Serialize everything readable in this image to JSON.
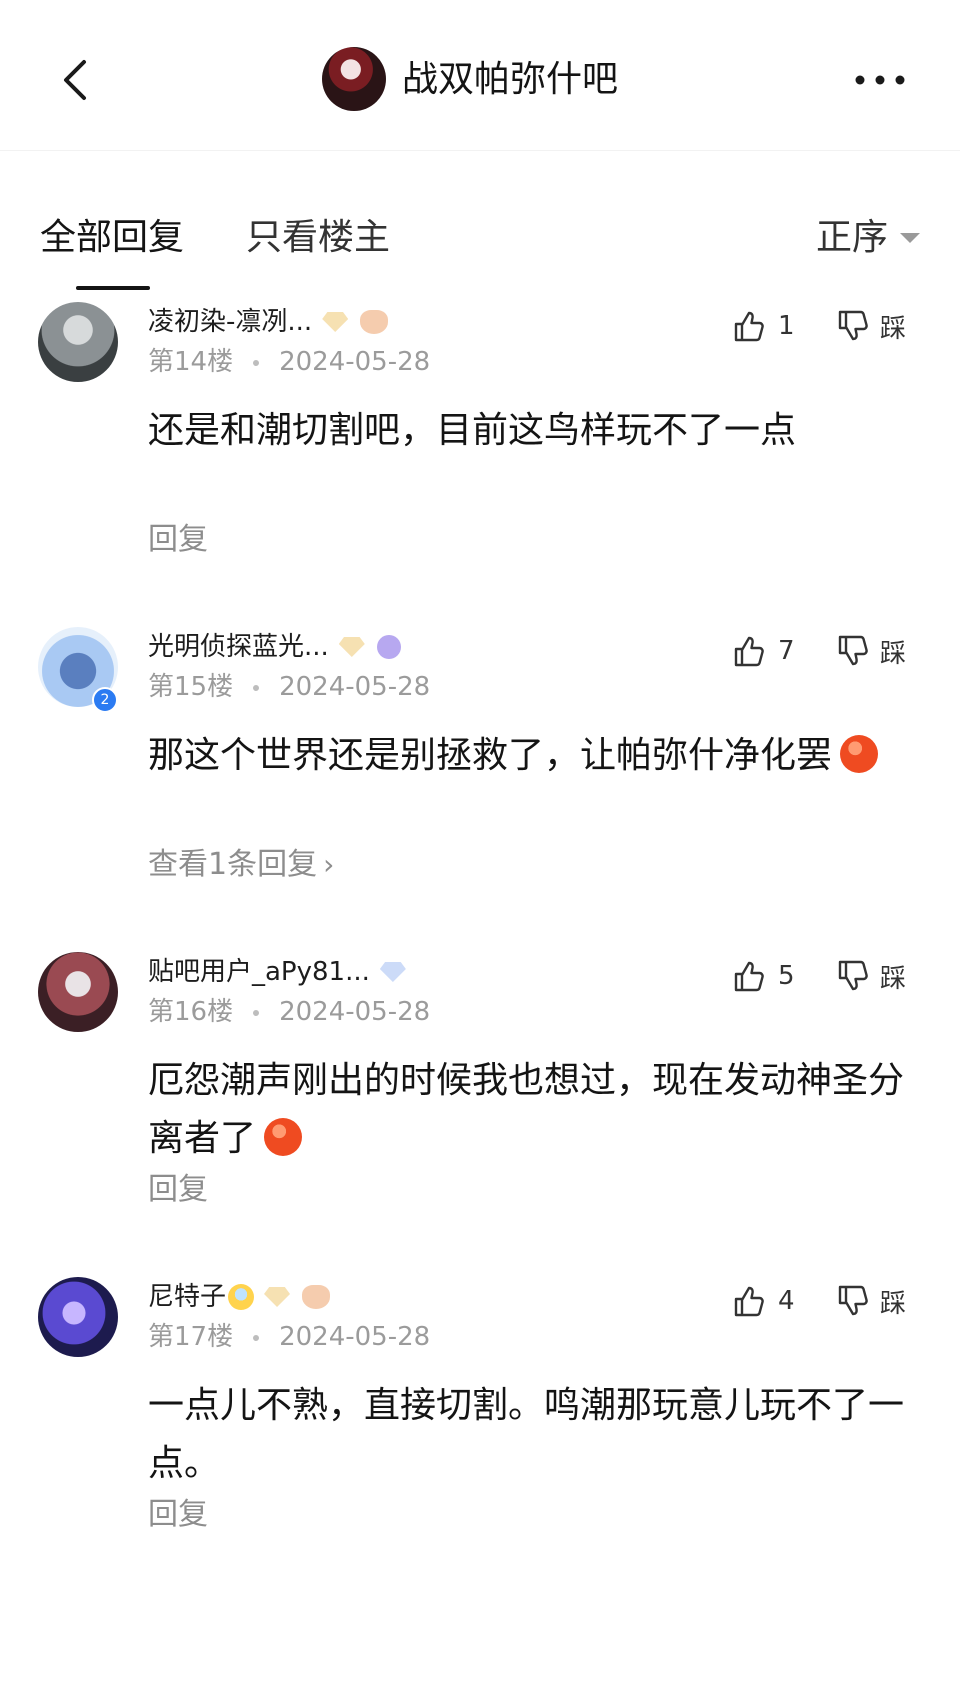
{
  "header": {
    "back_icon": "chevron-left-icon",
    "forum_title": "战双帕弥什吧",
    "more_icon": "more-dots-icon"
  },
  "tabs": {
    "all": "全部回复",
    "op_only": "只看楼主",
    "sort": "正序"
  },
  "comments": [
    {
      "username": "凌初染-凛冽...",
      "floor": "第14楼",
      "date": "2024-05-28",
      "likes": "1",
      "dislike": "踩",
      "content": "还是和潮切割吧，目前这鸟样玩不了一点",
      "action": "回复"
    },
    {
      "username": "光明侦探蓝光...",
      "floor": "第15楼",
      "date": "2024-05-28",
      "likes": "7",
      "dislike": "踩",
      "content": "那这个世界还是别拯救了，让帕弥什净化罢",
      "avatar_level": "2",
      "action": "查看1条回复"
    },
    {
      "username": "贴吧用户_aPy81...",
      "floor": "第16楼",
      "date": "2024-05-28",
      "likes": "5",
      "dislike": "踩",
      "content": "厄怨潮声刚出的时候我也想过，现在发动神圣分离者了",
      "action": "回复"
    },
    {
      "username": "尼特子",
      "floor": "第17楼",
      "date": "2024-05-28",
      "likes": "4",
      "dislike": "踩",
      "content": "一点儿不熟，直接切割。鸣潮那玩意儿玩不了一点。",
      "action": "回复"
    }
  ],
  "colors": {
    "text_primary": "#141414",
    "text_secondary": "#9b9b9b",
    "background": "#ffffff"
  }
}
